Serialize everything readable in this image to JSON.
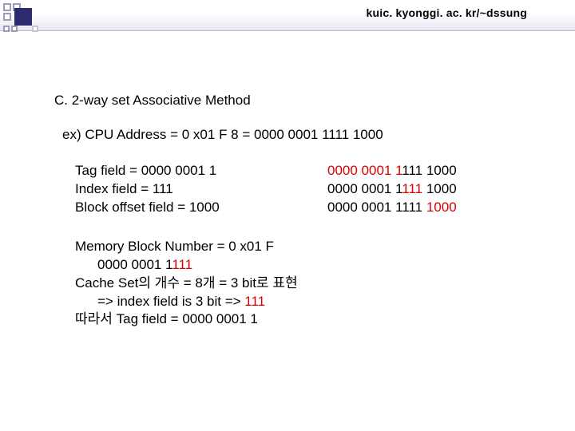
{
  "header": {
    "url": "kuic. kyonggi. ac. kr/~dssung"
  },
  "section_title": "C. 2-way set Associative Method",
  "example_line": "ex) CPU Address = 0 x01 F 8 = 0000 0001 1111 1000",
  "fields": {
    "tag": "Tag field = 0000 0001 1",
    "index": "Index field = 111",
    "block": "Block offset field = 1000"
  },
  "right_col": {
    "l1_a": "0000 0001 1",
    "l1_b": "111 1000",
    "l2_a": "0000 0001 1",
    "l2_b": "111",
    "l2_c": " 1000",
    "l3_a": "0000 0001 1111 ",
    "l3_b": "1000"
  },
  "info": {
    "l1": "Memory Block Number = 0 x01 F",
    "l2a": "0000 0001 1",
    "l2b": "111",
    "l3": "Cache Set의 개수 = 8개 = 3 bit로 표현",
    "l4a": "=> index field is 3 bit => ",
    "l4b": "111",
    "l5": "따라서 Tag field = 0000 0001 1"
  }
}
